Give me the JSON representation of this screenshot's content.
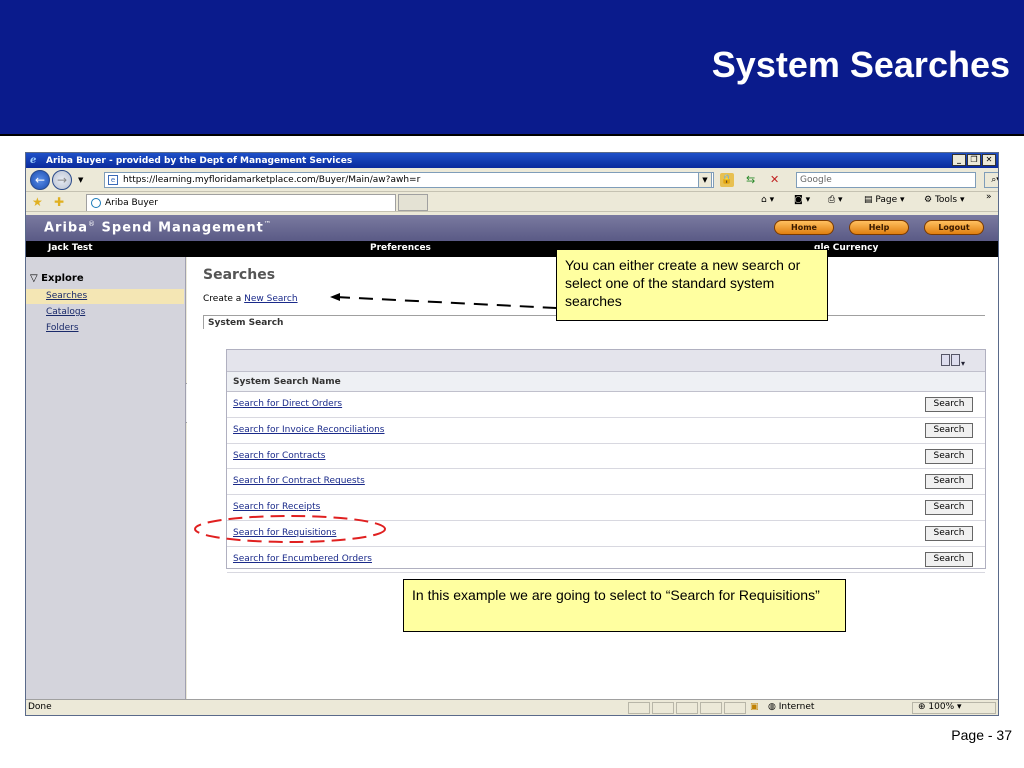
{
  "slide": {
    "title": "System Searches",
    "page_label": "Page - 37"
  },
  "browser": {
    "window_title": "Ariba Buyer - provided by the Dept of Management Services",
    "url": "https://learning.myfloridamarketplace.com/Buyer/Main/aw?awh=r",
    "search_placeholder": "Google",
    "tab_title": "Ariba Buyer",
    "page_menu": "Page",
    "tools_menu": "Tools",
    "status_text": "Done",
    "zone_text": "Internet",
    "zoom_text": "100%"
  },
  "ariba": {
    "logo": "Ariba",
    "logo_reg": "®",
    "logo_rest": " Spend Management",
    "logo_tm": "™",
    "home_button": "Home",
    "help_button": "Help",
    "logout_button": "Logout",
    "user_name": "Jack Test",
    "nav_preferences": "Preferences",
    "nav_currency": "gle Currency"
  },
  "sidebar": {
    "heading": "Explore",
    "items": [
      {
        "label": "Searches"
      },
      {
        "label": "Catalogs"
      },
      {
        "label": "Folders"
      }
    ]
  },
  "main": {
    "title": "Searches",
    "create_prefix": "Create a ",
    "new_search_link": "New Search",
    "section_tab": "System Search",
    "column_header": "System Search Name",
    "search_button_label": "Search",
    "rows": [
      {
        "name": "Search for Direct Orders"
      },
      {
        "name": "Search for Invoice Reconciliations"
      },
      {
        "name": "Search for Contracts"
      },
      {
        "name": "Search for Contract Requests"
      },
      {
        "name": "Search for Receipts"
      },
      {
        "name": "Search for Requisitions"
      },
      {
        "name": "Search for Encumbered Orders"
      }
    ]
  },
  "callouts": {
    "top": "You can either create a new search or select one of the standard system searches",
    "bottom": "In this example we are going to select to “Search for Requisitions”"
  },
  "colors": {
    "slide_header": "#0a1b8c",
    "callout_fill": "#ffffa0",
    "highlight_ellipse": "#e02020"
  }
}
